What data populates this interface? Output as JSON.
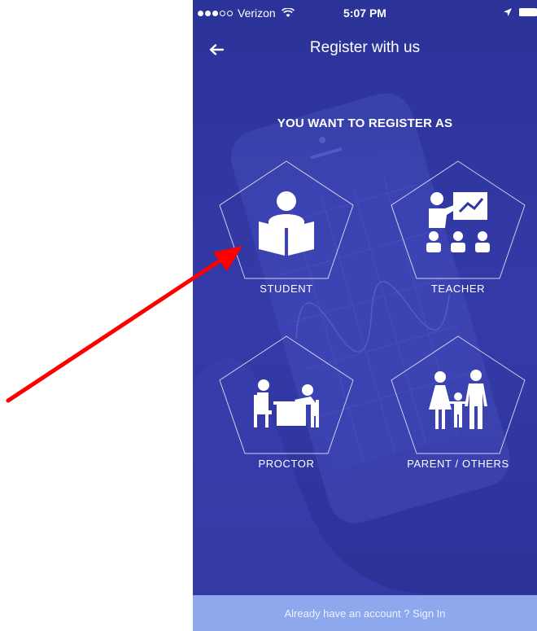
{
  "status_bar": {
    "carrier": "Verizon",
    "time": "5:07 PM",
    "signal_icon": "signal-dots-icon",
    "wifi_icon": "wifi-icon",
    "location_icon": "location-arrow-icon",
    "battery_icon": "battery-icon"
  },
  "navbar": {
    "back_icon": "back-arrow-icon",
    "title": "Register with us"
  },
  "main": {
    "prompt": "YOU WANT TO REGISTER AS",
    "roles": [
      {
        "label": "STUDENT",
        "icon": "student-reading-icon"
      },
      {
        "label": "TEACHER",
        "icon": "teacher-board-icon"
      },
      {
        "label": "PROCTOR",
        "icon": "proctor-desk-icon"
      },
      {
        "label": "PARENT / OTHERS",
        "icon": "family-icon"
      }
    ]
  },
  "footer": {
    "signin_text": "Already have an account ? Sign In"
  },
  "colors": {
    "background": "#2f35a3",
    "footer": "#8ea8ee",
    "annotation_arrow": "#ff0000"
  }
}
